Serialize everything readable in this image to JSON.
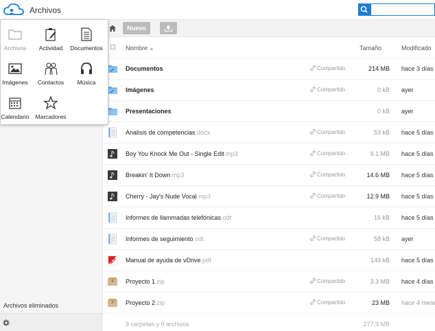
{
  "header": {
    "app_title": "Archivos",
    "search_placeholder": ""
  },
  "app_menu": {
    "items": [
      {
        "label": "Archivos",
        "icon": "folder-icon",
        "active": false
      },
      {
        "label": "Actividad",
        "icon": "clipboard-icon",
        "active": true
      },
      {
        "label": "Documentos",
        "icon": "document-icon",
        "active": true
      },
      {
        "label": "Imágenes",
        "icon": "image-icon",
        "active": true
      },
      {
        "label": "Contactos",
        "icon": "people-icon",
        "active": true
      },
      {
        "label": "Música",
        "icon": "headphones-icon",
        "active": true
      },
      {
        "label": "Calendario",
        "icon": "calendar-icon",
        "active": true
      },
      {
        "label": "Marcadores",
        "icon": "star-icon",
        "active": true
      }
    ]
  },
  "sidebar": {
    "trash_label": "Archivos eliminados"
  },
  "controls": {
    "new_label": "Nuevo"
  },
  "table": {
    "headers": {
      "name": "Nombre",
      "size": "Tamaño",
      "modified": "Modificado",
      "sort_indicator": "▲"
    },
    "rows": [
      {
        "name": "Documentos",
        "ext": "",
        "type": "folder",
        "shared": true,
        "share_label": "Compartido",
        "size": "214 MB",
        "modified": "hace 3 días"
      },
      {
        "name": "Imágenes",
        "ext": "",
        "type": "folder",
        "shared": true,
        "share_label": "Compartido",
        "size": "0 kB",
        "modified": "ayer"
      },
      {
        "name": "Presentaciones",
        "ext": "",
        "type": "folder",
        "shared": false,
        "share_label": "",
        "size": "0 kB",
        "modified": "ayer"
      },
      {
        "name": "Analisis de competencias",
        "ext": ".docx",
        "type": "text",
        "shared": true,
        "share_label": "Compartido",
        "size": "53 kB",
        "modified": "hace 5 días"
      },
      {
        "name": "Boy You Knock Me Out - Single Edit",
        "ext": ".mp3",
        "type": "audio",
        "shared": true,
        "share_label": "Compartido",
        "size": "9.1 MB",
        "modified": "hace 5 días"
      },
      {
        "name": "Breakin' It Down",
        "ext": ".mp3",
        "type": "audio",
        "shared": true,
        "share_label": "Compartido",
        "size": "14.6 MB",
        "modified": "hace 5 días"
      },
      {
        "name": "Cherry - Jay's Nude Vocal",
        "ext": ".mp3",
        "type": "audio",
        "shared": true,
        "share_label": "Compartido",
        "size": "12.9 MB",
        "modified": "hace 5 días"
      },
      {
        "name": "Informes de llammadas telefónicas",
        "ext": ".odt",
        "type": "text",
        "shared": false,
        "share_label": "",
        "size": "16 kB",
        "modified": "hace 5 días"
      },
      {
        "name": "Informes de seguimiento",
        "ext": ".odt",
        "type": "text",
        "shared": true,
        "share_label": "Compartido",
        "size": "58 kB",
        "modified": "ayer"
      },
      {
        "name": "Manual de ayuda de vDrive",
        "ext": ".pdf",
        "type": "pdf",
        "shared": false,
        "share_label": "",
        "size": "149 kB",
        "modified": "hace 5 días"
      },
      {
        "name": "Proyecto 1",
        "ext": ".zip",
        "type": "zip",
        "shared": true,
        "share_label": "Compartido",
        "size": "3.3 MB",
        "modified": "hace 4 días"
      },
      {
        "name": "Proyecto 2",
        "ext": ".zip",
        "type": "zip",
        "shared": true,
        "share_label": "Compartido",
        "size": "23 MB",
        "modified": "hace 4 meses"
      }
    ],
    "summary": {
      "text": "3 carpetas y 9 archivos",
      "total_size": "277.3 MB"
    }
  },
  "colors": {
    "accent": "#1d7dd4",
    "folder": "#6aaee8"
  }
}
